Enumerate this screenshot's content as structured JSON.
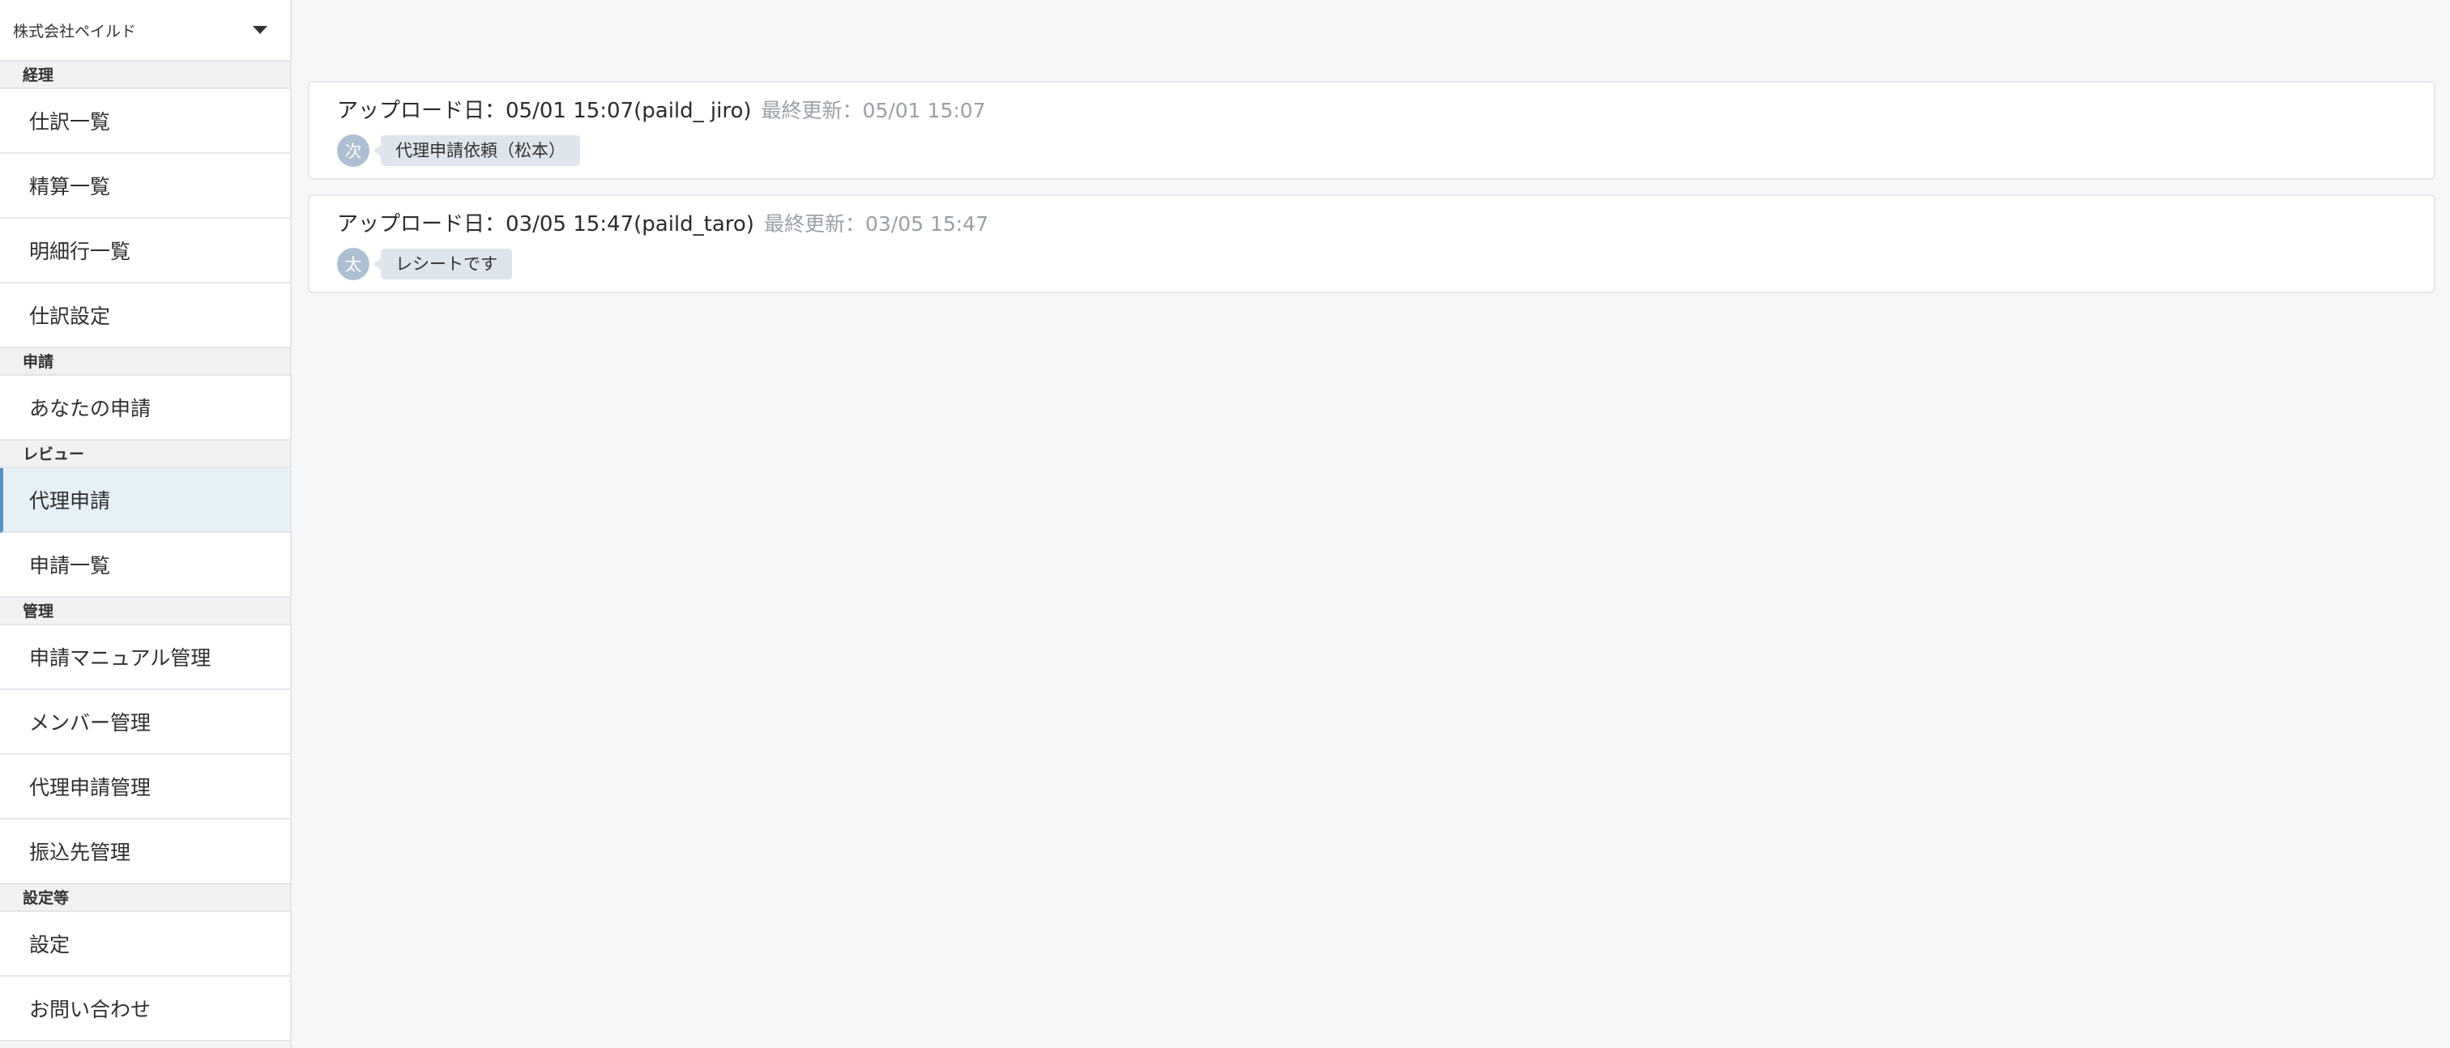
{
  "sidebar": {
    "company": "株式会社ペイルド",
    "sections": [
      {
        "header": "経理",
        "items": [
          "仕訳一覧",
          "精算一覧",
          "明細行一覧",
          "仕訳設定"
        ]
      },
      {
        "header": "申請",
        "items": [
          "あなたの申請"
        ]
      },
      {
        "header": "レビュー",
        "items": [
          "代理申請",
          "申請一覧"
        ]
      },
      {
        "header": "管理",
        "items": [
          "申請マニュアル管理",
          "メンバー管理",
          "代理申請管理",
          "振込先管理"
        ]
      },
      {
        "header": "設定等",
        "items": [
          "設定",
          "お問い合わせ"
        ]
      }
    ],
    "active_item": "代理申請"
  },
  "cards": [
    {
      "upload": "アップロード日：05/01 15:07(paild_ jiro)",
      "updated": "最終更新：05/01 15:07",
      "avatar": "次",
      "comment": "代理申請依頼（松本）"
    },
    {
      "upload": "アップロード日：03/05 15:47(paild_taro)",
      "updated": "最終更新：03/05 15:47",
      "avatar": "太",
      "comment": "レシートです"
    }
  ]
}
